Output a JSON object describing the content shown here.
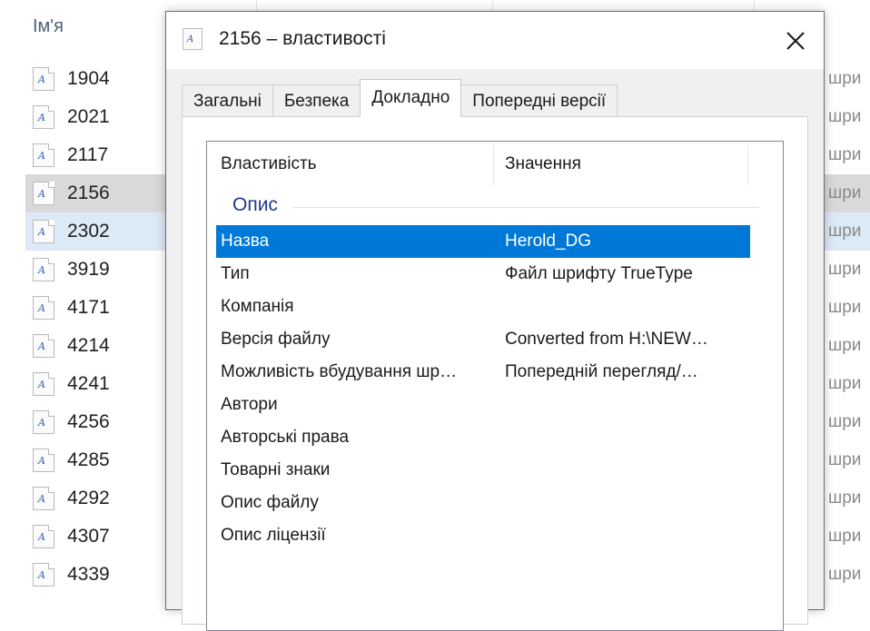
{
  "explorer": {
    "column_name": "Ім'я",
    "files": [
      {
        "name": "1904",
        "state": ""
      },
      {
        "name": "2021",
        "state": ""
      },
      {
        "name": "2117",
        "state": ""
      },
      {
        "name": "2156",
        "state": "sel-gray"
      },
      {
        "name": "2302",
        "state": "sel-blue"
      },
      {
        "name": "3919",
        "state": ""
      },
      {
        "name": "4171",
        "state": ""
      },
      {
        "name": "4214",
        "state": ""
      },
      {
        "name": "4241",
        "state": ""
      },
      {
        "name": "4256",
        "state": ""
      },
      {
        "name": "4285",
        "state": ""
      },
      {
        "name": "4292",
        "state": ""
      },
      {
        "name": "4307",
        "state": ""
      },
      {
        "name": "4339",
        "state": ""
      }
    ],
    "type_fragment": "шри",
    "file_icon": "font-file-icon"
  },
  "dialog": {
    "title": "2156 – властивості",
    "title_icon": "font-file-icon",
    "close_icon": "close-icon",
    "tabs": [
      {
        "label": "Загальні",
        "active": false
      },
      {
        "label": "Безпека",
        "active": false
      },
      {
        "label": "Докладно",
        "active": true
      },
      {
        "label": "Попередні версії",
        "active": false
      }
    ],
    "header": {
      "property": "Властивість",
      "value": "Значення"
    },
    "group": "Опис",
    "rows": [
      {
        "name": "Назва",
        "value": "Herold_DG",
        "selected": true
      },
      {
        "name": "Тип",
        "value": "Файл шрифту TrueType",
        "selected": false
      },
      {
        "name": "Компанія",
        "value": "",
        "selected": false
      },
      {
        "name": "Версія файлу",
        "value": "Converted from H:\\NEW…",
        "selected": false
      },
      {
        "name": "Можливість вбудування шр…",
        "value": "Попередній перегляд/…",
        "selected": false
      },
      {
        "name": "Автори",
        "value": "",
        "selected": false
      },
      {
        "name": "Авторські права",
        "value": "",
        "selected": false
      },
      {
        "name": "Товарні знаки",
        "value": "",
        "selected": false
      },
      {
        "name": "Опис файлу",
        "value": "",
        "selected": false
      },
      {
        "name": "Опис ліцензії",
        "value": "",
        "selected": false
      }
    ],
    "colors": {
      "selection": "#0078d7",
      "group_label": "#1e3a8a"
    }
  }
}
